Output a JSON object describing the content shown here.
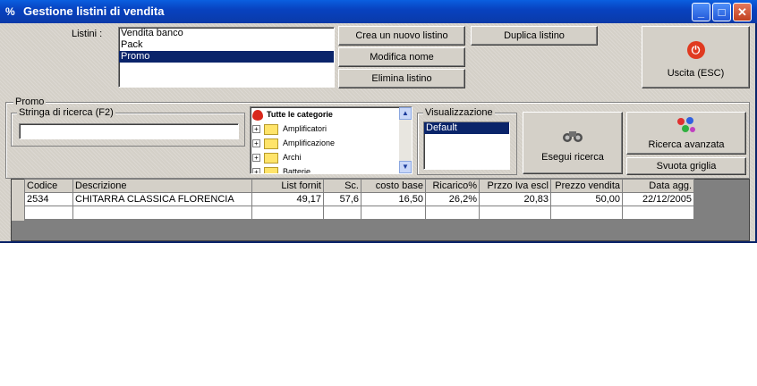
{
  "window": {
    "title": "Gestione listini di vendita",
    "minimize": "_",
    "maximize": "□",
    "close": "✕"
  },
  "listini": {
    "label": "Listini :",
    "items": [
      "Vendita banco",
      "Pack",
      "Promo"
    ],
    "selected": "Promo"
  },
  "buttons": {
    "new_list": "Crea un nuovo listino",
    "rename": "Modifica nome",
    "delete": "Elimina listino",
    "duplicate": "Duplica listino",
    "exit": "Uscita (ESC)",
    "search": "Esegui ricerca",
    "advanced": "Ricerca avanzata",
    "clear": "Svuota griglia"
  },
  "promo_group": {
    "title": "Promo"
  },
  "search": {
    "label": "Stringa di ricerca (F2)",
    "value": ""
  },
  "categories": {
    "root": "Tutte le categorie",
    "items": [
      "Amplificatori",
      "Amplificazione",
      "Archi",
      "Batterie"
    ]
  },
  "visualizzazione": {
    "label": "Visualizzazione",
    "items": [
      "Default"
    ],
    "selected": "Default"
  },
  "grid": {
    "columns": [
      "Codice",
      "Descrizione",
      "List fornit",
      "Sc.",
      "costo base",
      "Ricarico%",
      "Przzo Iva escl",
      "Prezzo vendita",
      "Data agg."
    ],
    "rows": [
      [
        "2534",
        "CHITARRA CLASSICA FLORENCIA",
        "49,17",
        "57,6",
        "16,50",
        "26,2%",
        "20,83",
        "50,00",
        "22/12/2005"
      ]
    ]
  },
  "icons": {
    "window": "app-icon",
    "exit": "power-icon",
    "search": "binoculars-icon",
    "advanced": "molecule-icon",
    "root_category": "strawberry-icon",
    "folder": "folder-icon"
  }
}
